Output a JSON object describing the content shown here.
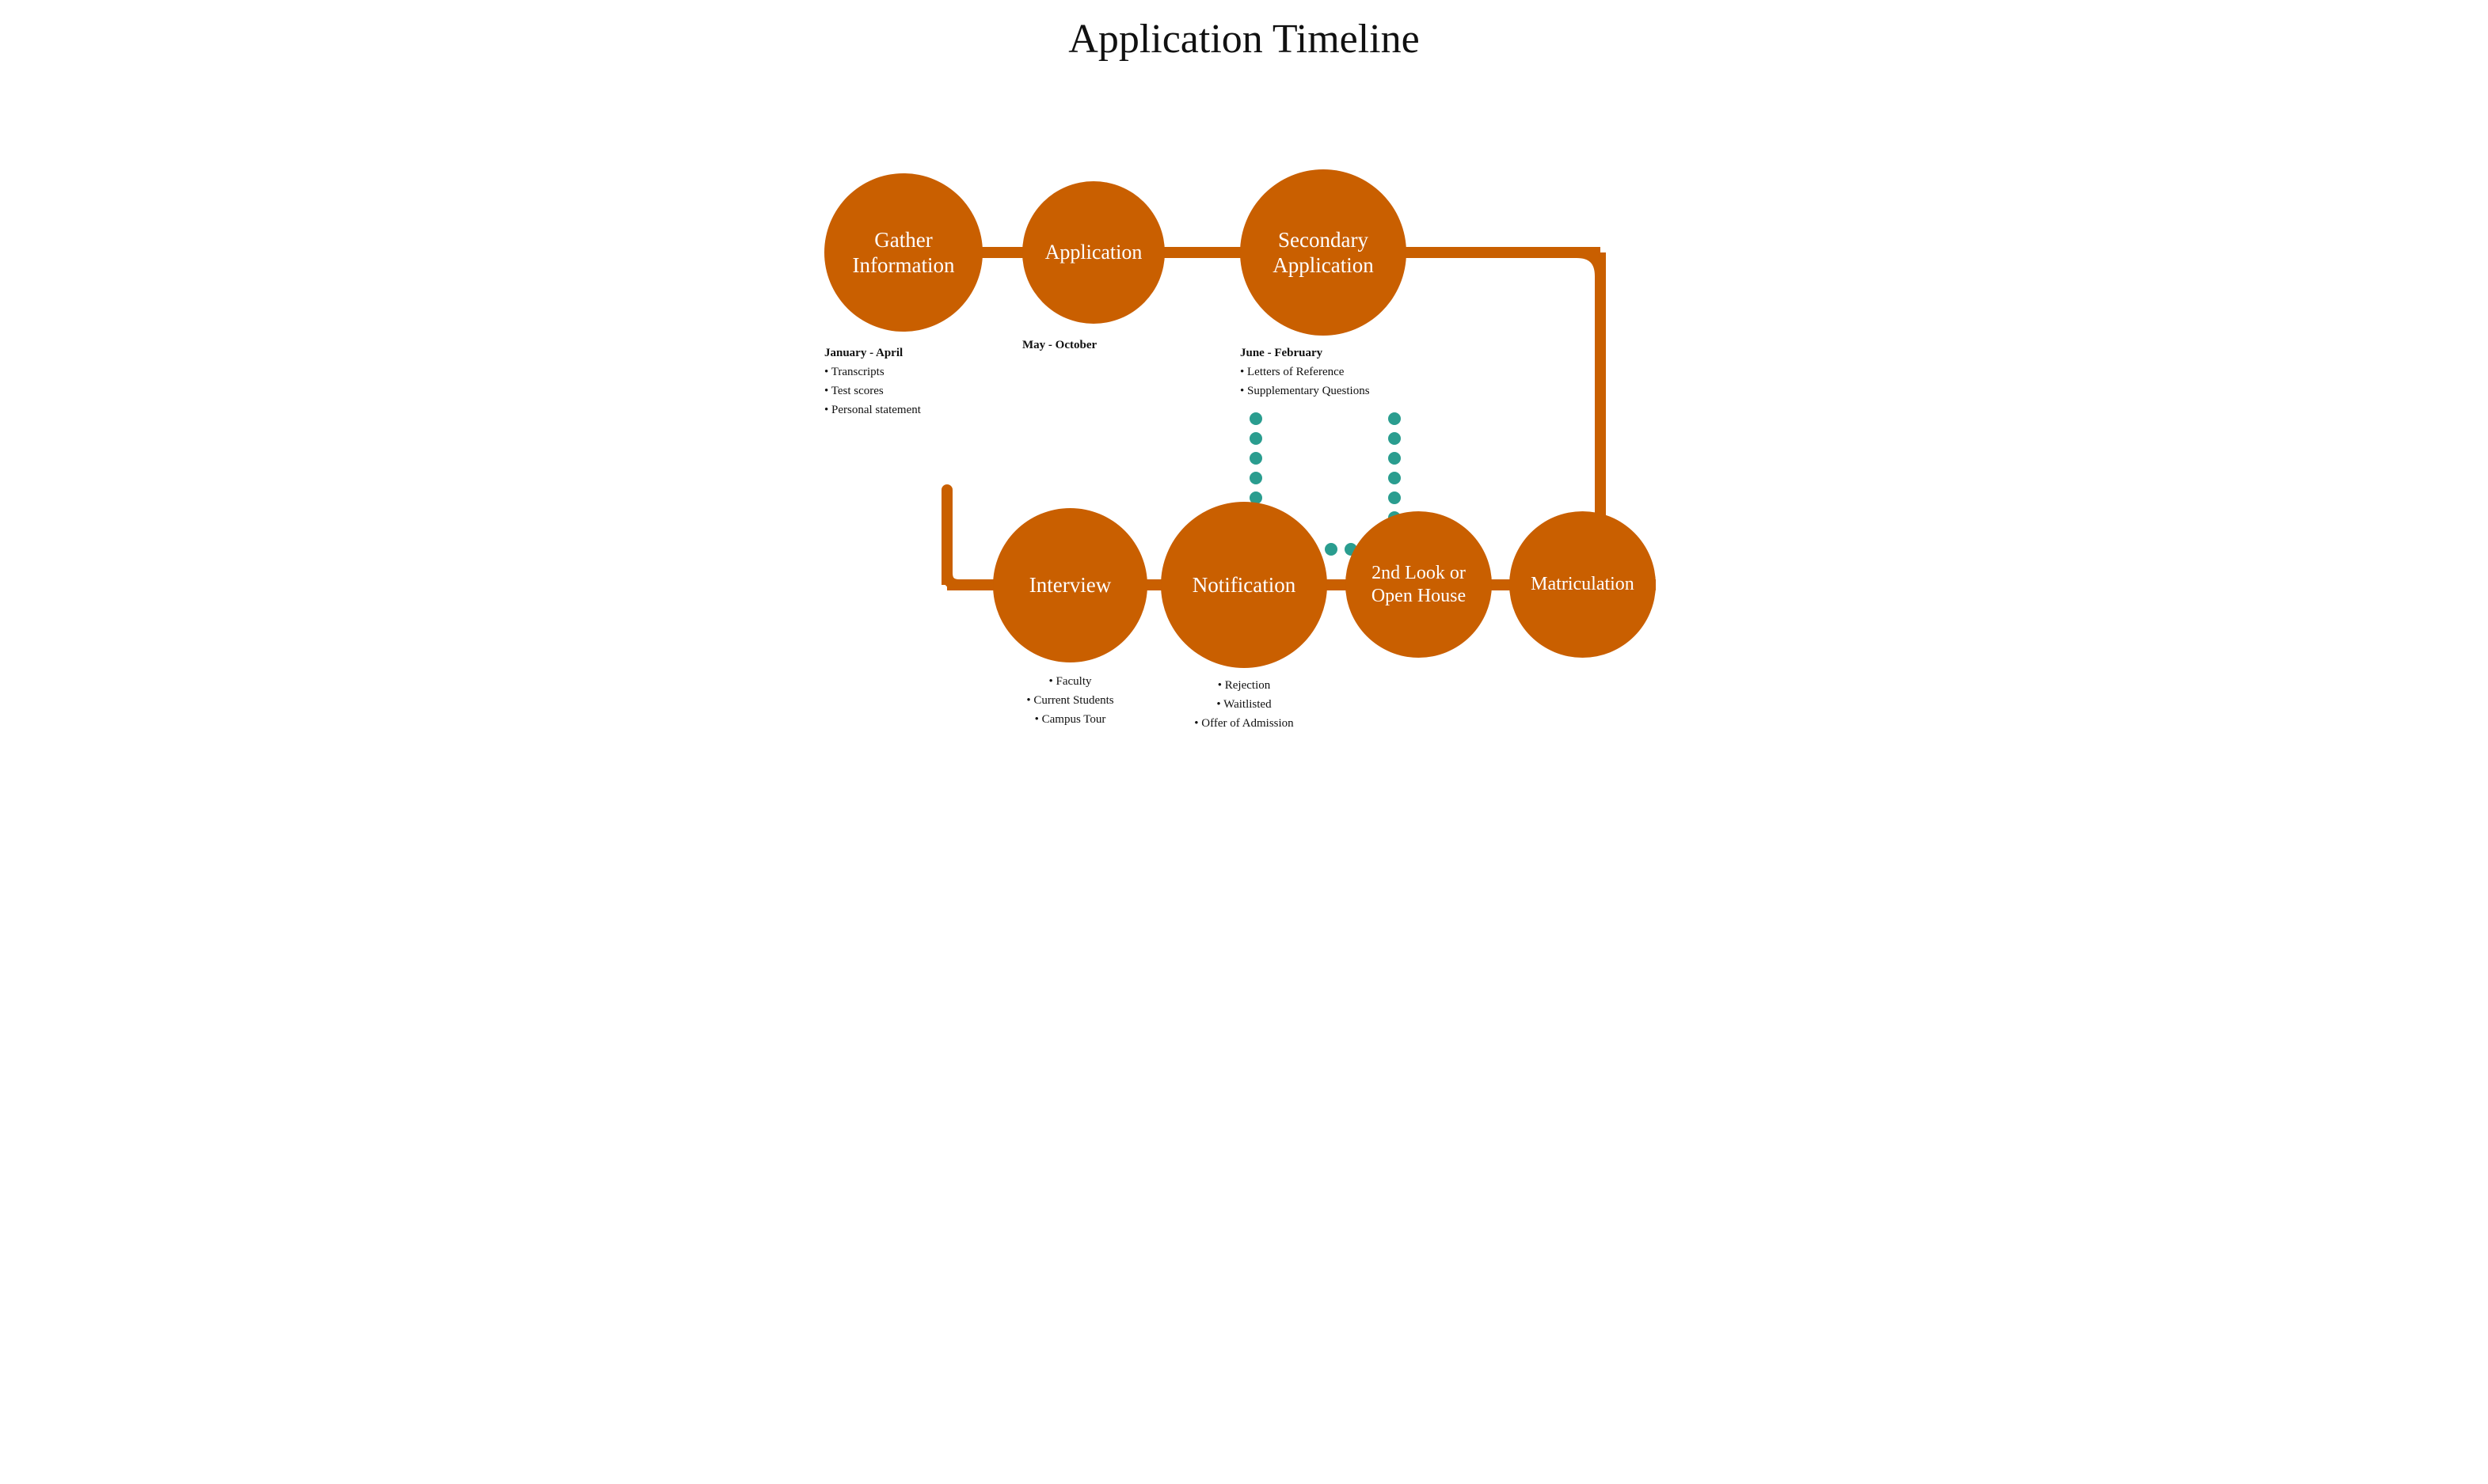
{
  "title": "Application Timeline",
  "nodes_top": [
    {
      "id": "gather-info",
      "label": "Gather\nInformation",
      "date": "January - April",
      "bullets": [
        "Transcripts",
        "Test scores",
        "Personal statement"
      ],
      "size": 200
    },
    {
      "id": "application",
      "label": "Application",
      "date": "May - October",
      "bullets": [],
      "size": 180
    },
    {
      "id": "secondary-application",
      "label": "Secondary\nApplication",
      "date": "June - February",
      "bullets": [
        "Letters of Reference",
        "Supplementary Questions"
      ],
      "size": 210
    }
  ],
  "nodes_bottom": [
    {
      "id": "interview",
      "label": "Interview",
      "date": "",
      "bullets": [
        "Faculty",
        "Current Students",
        "Campus Tour"
      ],
      "size": 190
    },
    {
      "id": "notification",
      "label": "Notification",
      "date": "",
      "bullets": [
        "Rejection",
        "Waitlisted",
        "Offer of Admission"
      ],
      "size": 210
    },
    {
      "id": "second-look",
      "label": "2nd Look or\nOpen House",
      "date": "",
      "bullets": [],
      "size": 185
    },
    {
      "id": "matriculation",
      "label": "Matriculation",
      "date": "",
      "bullets": [],
      "size": 185
    }
  ],
  "colors": {
    "orange": "#c95f00",
    "teal": "#2a9d8f",
    "text": "#111111",
    "white": "#ffffff"
  }
}
